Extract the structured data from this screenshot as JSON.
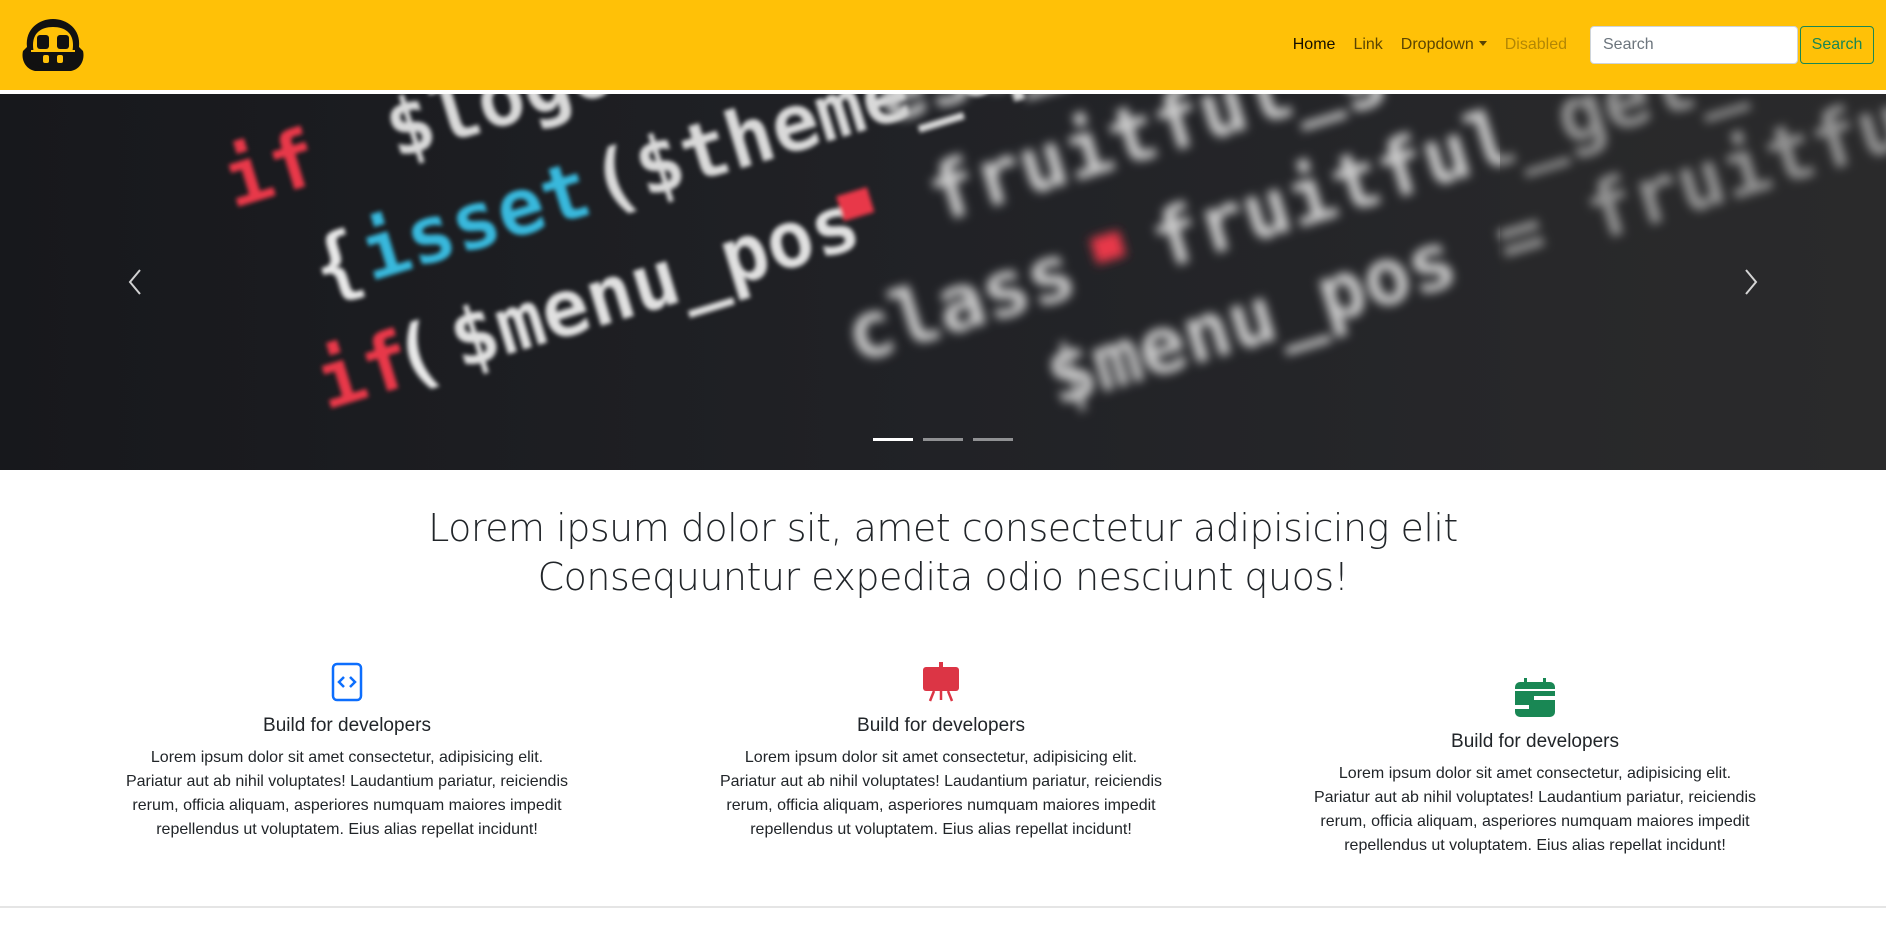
{
  "navbar": {
    "logo_icon": "robot-head-logo-icon",
    "links": [
      {
        "label": "Home",
        "active": true
      },
      {
        "label": "Link"
      },
      {
        "label": "Dropdown"
      },
      {
        "label": "Disabled",
        "disabled": true
      }
    ],
    "search": {
      "placeholder": "Search",
      "value": "",
      "button_label": "Search"
    },
    "colors": {
      "background": "#ffc107",
      "search_button": "#198754"
    }
  },
  "carousel": {
    "slide_image": "code-editor-photo",
    "slide_count": 3,
    "active_index": 0,
    "prev_icon": "chevron-left-icon",
    "next_icon": "chevron-right-icon"
  },
  "headline": {
    "line1": "Lorem ipsum dolor sit, amet consectetur adipisicing elit",
    "line2": "Consequuntur expedita odio nesciunt quos!"
  },
  "features": [
    {
      "icon": "code-file-icon",
      "color": "#0d6efd",
      "title": "Build for developers",
      "text": "Lorem ipsum dolor sit amet consectetur, adipisicing elit. Pariatur aut ab nihil voluptates! Laudantium pariatur, reiciendis rerum, officia aliquam, asperiores numquam maiores impedit repellendus ut voluptatem. Eius alias repellat incidunt!"
    },
    {
      "icon": "easel-presentation-icon",
      "color": "#dc3545",
      "title": "Build for developers",
      "text": "Lorem ipsum dolor sit amet consectetur, adipisicing elit. Pariatur aut ab nihil voluptates! Laudantium pariatur, reiciendis rerum, officia aliquam, asperiores numquam maiores impedit repellendus ut voluptatem. Eius alias repellat incidunt!"
    },
    {
      "icon": "calendar-range-icon",
      "color": "#198754",
      "title": "Build for developers",
      "text": "Lorem ipsum dolor sit amet consectetur, adipisicing elit. Pariatur aut ab nihil voluptates! Laudantium pariatur, reiciendis rerum, officia aliquam, asperiores numquam maiores impedit repellendus ut voluptatem. Eius alias repellat incidunt!"
    }
  ]
}
